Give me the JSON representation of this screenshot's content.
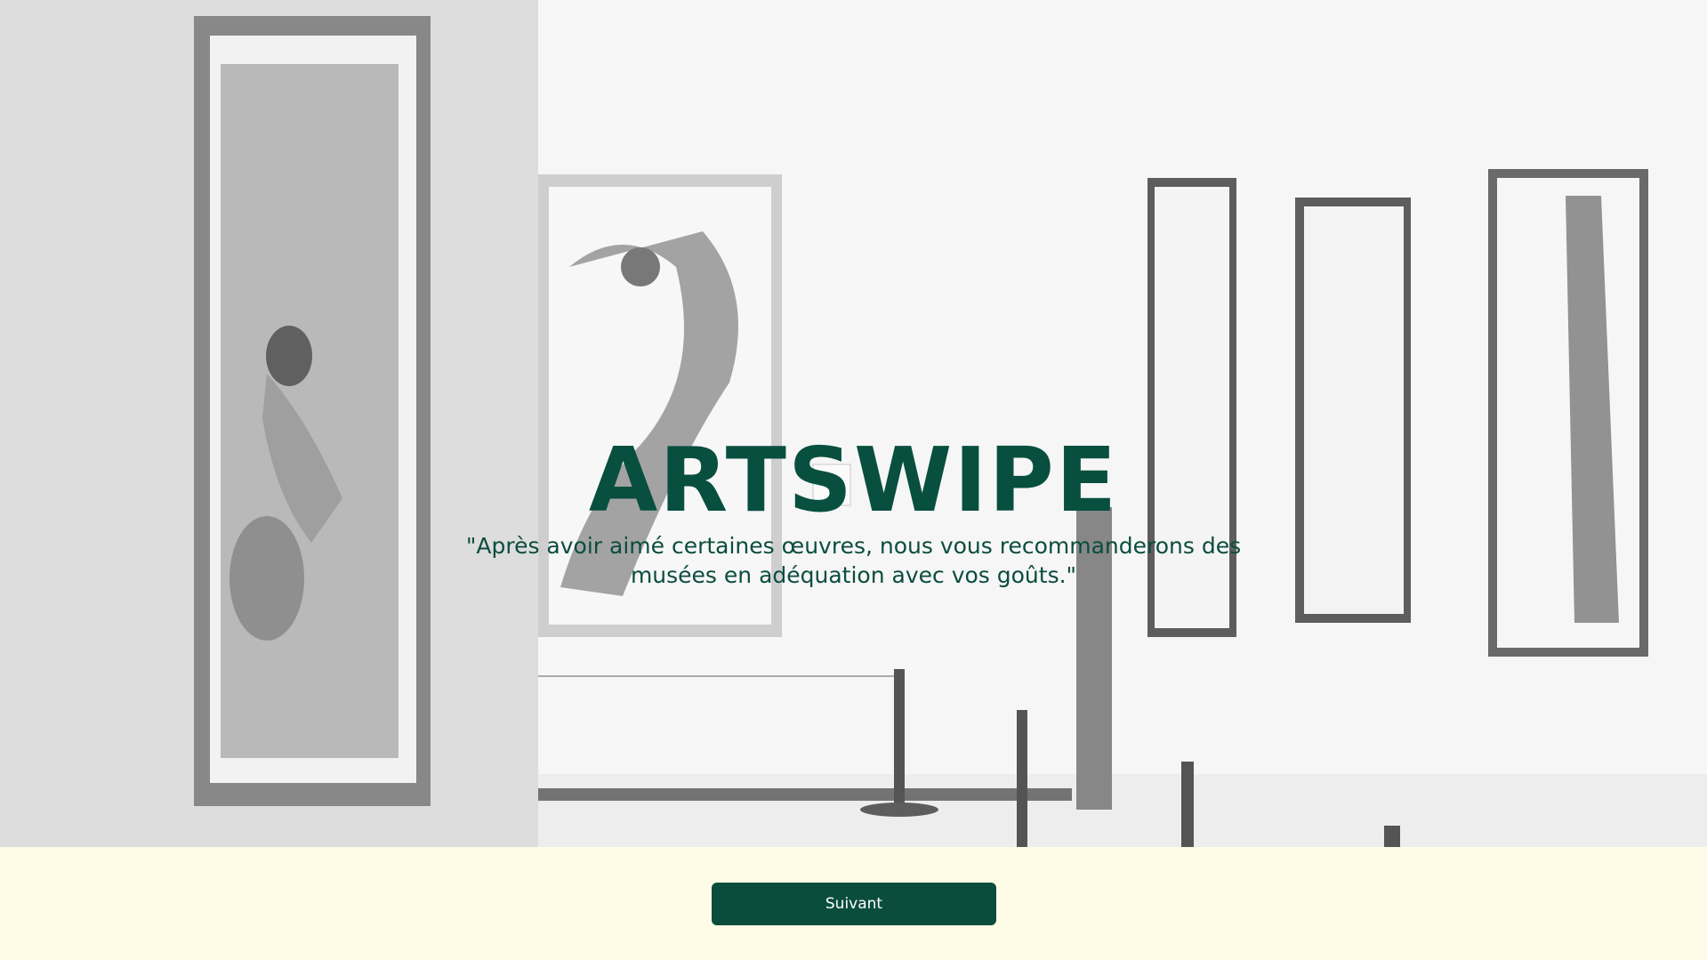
{
  "hero": {
    "background_image": "art-gallery-black-and-white-photo",
    "title": "ARTSWIPE",
    "quote": "\"Après avoir aimé certaines œuvres, nous vous recommanderons des musées en adéquation avec vos goûts.\""
  },
  "footer": {
    "next_label": "Suivant"
  },
  "colors": {
    "brand_green": "#0b4d3d",
    "footer_background": "#fefbe6",
    "button_text": "#ffffff"
  }
}
